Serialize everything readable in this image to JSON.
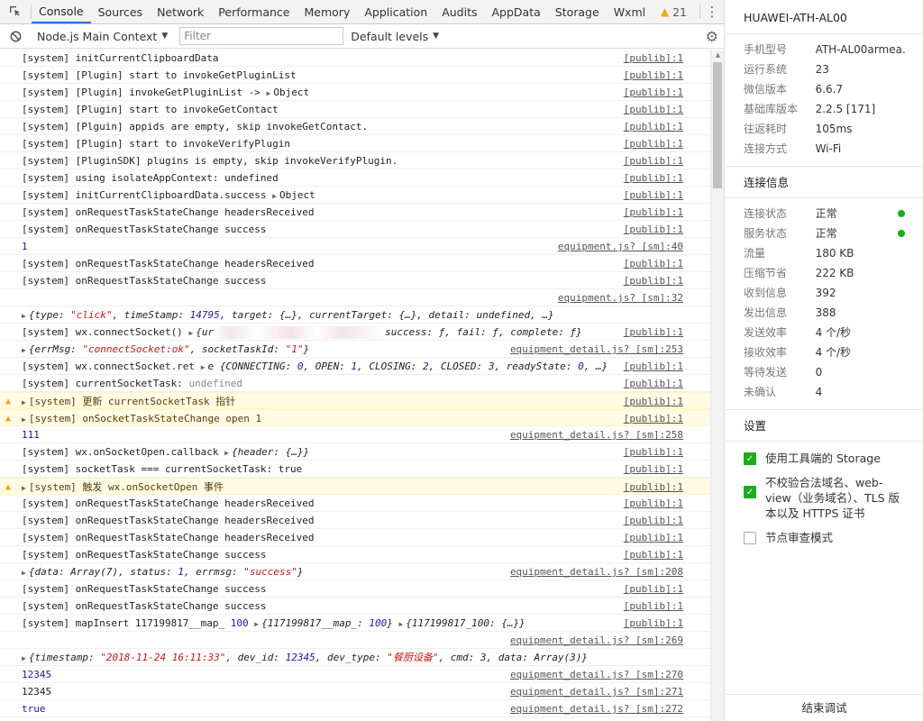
{
  "tabbar": {
    "tabs": [
      "Console",
      "Sources",
      "Network",
      "Performance",
      "Memory",
      "Application",
      "Audits",
      "AppData",
      "Storage",
      "Wxml"
    ],
    "warnings_count": "21"
  },
  "toolbar": {
    "context": "Node.js Main Context",
    "filter_placeholder": "Filter",
    "levels": "Default levels"
  },
  "console": {
    "r1": {
      "msg": "[system] initCurrentClipboardData",
      "src": "[publib]:1"
    },
    "r2": {
      "msg": "[system] [Plugin] start to invokeGetPluginList",
      "src": "[publib]:1"
    },
    "r3": {
      "msg": "[system] [Plugin] invokeGetPluginList -> ",
      "obj": "Object",
      "src": "[publib]:1"
    },
    "r4": {
      "msg": "[system] [Plugin] start to invokeGetContact",
      "src": "[publib]:1"
    },
    "r5": {
      "msg": "[system] [Plguin] appids are empty, skip invokeGetContact.",
      "src": "[publib]:1"
    },
    "r6": {
      "msg": "[system] [Plugin] start to invokeVerifyPlugin",
      "src": "[publib]:1"
    },
    "r7": {
      "msg": "[system] [PluginSDK] plugins is empty, skip invokeVerifyPlugin.",
      "src": "[publib]:1"
    },
    "r8": {
      "msg": "[system] using isolateAppContext: undefined",
      "src": "[publib]:1"
    },
    "r9": {
      "msg": "[system] initCurrentClipboardData.success ",
      "obj": "Object",
      "src": "[publib]:1"
    },
    "r10": {
      "msg": "[system] onRequestTaskStateChange headersReceived",
      "src": "[publib]:1"
    },
    "r11": {
      "msg": "[system] onRequestTaskStateChange success",
      "src": "[publib]:1"
    },
    "r12": {
      "msg": "1",
      "src": "equipment.js? [sm]:40"
    },
    "r13": {
      "msg": "[system] onRequestTaskStateChange headersReceived",
      "src": "[publib]:1"
    },
    "r14": {
      "msg": "[system] onRequestTaskStateChange success",
      "src": "[publib]:1"
    },
    "r15": {
      "src": "equipment.js? [sm]:32"
    },
    "r16": {
      "a": "{type: ",
      "b": "\"click\"",
      "c": ", timeStamp: ",
      "d": "14795",
      "e": ", target: {…}, currentTarget: {…}, detail: undefined, …}"
    },
    "r17": {
      "msg": "[system] wx.connectSocket() ",
      "a": "{ur",
      "b": "success: ƒ, fail: ƒ, complete: ƒ}",
      "src": "[publib]:1"
    },
    "r18": {
      "a": "{errMsg: ",
      "b": "\"connectSocket:ok\"",
      "c": ", socketTaskId: ",
      "d": "\"1\"",
      "e": "}",
      "src": "equipment_detail.js? [sm]:253"
    },
    "r19": {
      "msg": "[system] wx.connectSocket.ret ",
      "a": "e {CONNECTING: ",
      "b": "0",
      "c": ", OPEN: ",
      "d": "1",
      "e": ", CLOSING: ",
      "f": "2",
      "g": ", CLOSED: ",
      "h": "3",
      "i": ", readyState: ",
      "j": "0",
      "k": ", …}",
      "src": "[publib]:1"
    },
    "r20": {
      "msg": "[system] currentSocketTask: ",
      "gray": "undefined",
      "src": "[publib]:1"
    },
    "r21": {
      "msg": "[system] 更新 currentSocketTask 指针",
      "src": "[publib]:1"
    },
    "r22": {
      "msg": "[system] onSocketTaskStateChange open 1",
      "src": "[publib]:1"
    },
    "r23": {
      "msg": "111",
      "src": "equipment_detail.js? [sm]:258"
    },
    "r24": {
      "msg": "[system] wx.onSocketOpen.callback ",
      "a": "{header: {…}}",
      "src": "[publib]:1"
    },
    "r25": {
      "msg": "[system] socketTask === currentSocketTask: true",
      "src": "[publib]:1"
    },
    "r26": {
      "msg": "[system] 触发 wx.onSocketOpen 事件",
      "src": "[publib]:1"
    },
    "r27": {
      "msg": "[system] onRequestTaskStateChange headersReceived",
      "src": "[publib]:1"
    },
    "r28": {
      "msg": "[system] onRequestTaskStateChange headersReceived",
      "src": "[publib]:1"
    },
    "r29": {
      "msg": "[system] onRequestTaskStateChange headersReceived",
      "src": "[publib]:1"
    },
    "r30": {
      "msg": "[system] onRequestTaskStateChange success",
      "src": "[publib]:1"
    },
    "r31": {
      "a": "{data: Array(7), status: ",
      "b": "1",
      "c": ", errmsg: ",
      "d": "\"success\"",
      "e": "}",
      "src": "equipment_detail.js? [sm]:208"
    },
    "r32": {
      "msg": "[system] onRequestTaskStateChange success",
      "src": "[publib]:1"
    },
    "r33": {
      "msg": "[system] onRequestTaskStateChange success",
      "src": "[publib]:1"
    },
    "r34": {
      "msg": "[system] mapInsert 117199817__map_ ",
      "n": "100",
      "a": "{117199817__map_: ",
      "b": "100",
      "c": "}",
      "d": "{117199817_100: {…}}",
      "src": "[publib]:1"
    },
    "r35": {
      "src": "equipment_detail.js? [sm]:269"
    },
    "r36": {
      "a": "{timestamp: ",
      "b": "\"2018-11-24 16:11:33\"",
      "c": ", dev_id: ",
      "d": "12345",
      "e": ", dev_type: ",
      "f": "\"餐厨设备\"",
      "g": ", cmd: ",
      "h": "3",
      "i": ", data: Array(3)}"
    },
    "r37": {
      "msg": "12345",
      "src": "equipment_detail.js? [sm]:270"
    },
    "r38": {
      "msg": "12345",
      "src": "equipment_detail.js? [sm]:271"
    },
    "r39": {
      "msg": "true",
      "src": "equipment_detail.js? [sm]:272"
    }
  },
  "panel": {
    "device": "HUAWEI-ATH-AL00",
    "info": [
      {
        "k": "手机型号",
        "v": "ATH-AL00armea…"
      },
      {
        "k": "运行系统",
        "v": "23"
      },
      {
        "k": "微信版本",
        "v": "6.6.7"
      },
      {
        "k": "基础库版本",
        "v": "2.2.5 [171]"
      },
      {
        "k": "往返耗时",
        "v": "105ms"
      },
      {
        "k": "连接方式",
        "v": "Wi-Fi"
      }
    ],
    "conn_title": "连接信息",
    "conn": [
      {
        "k": "连接状态",
        "v": "正常"
      },
      {
        "k": "服务状态",
        "v": "正常"
      },
      {
        "k": "流量",
        "v": "180 KB"
      },
      {
        "k": "压缩节省",
        "v": "222 KB"
      },
      {
        "k": "收到信息",
        "v": "392"
      },
      {
        "k": "发出信息",
        "v": "388"
      },
      {
        "k": "发送效率",
        "v": "4 个/秒"
      },
      {
        "k": "接收效率",
        "v": "4 个/秒"
      },
      {
        "k": "等待发送",
        "v": "0"
      },
      {
        "k": "未确认",
        "v": "4"
      }
    ],
    "settings_title": "设置",
    "settings": [
      "使用工具端的 Storage",
      "不校验合法域名、web-view（业务域名）、TLS 版本以及 HTTPS 证书",
      "节点审查模式"
    ],
    "end_button": "结束调试"
  },
  "colors": {
    "accent": "#1a73e8",
    "success": "#1aad19",
    "warning": "#f2a600"
  }
}
